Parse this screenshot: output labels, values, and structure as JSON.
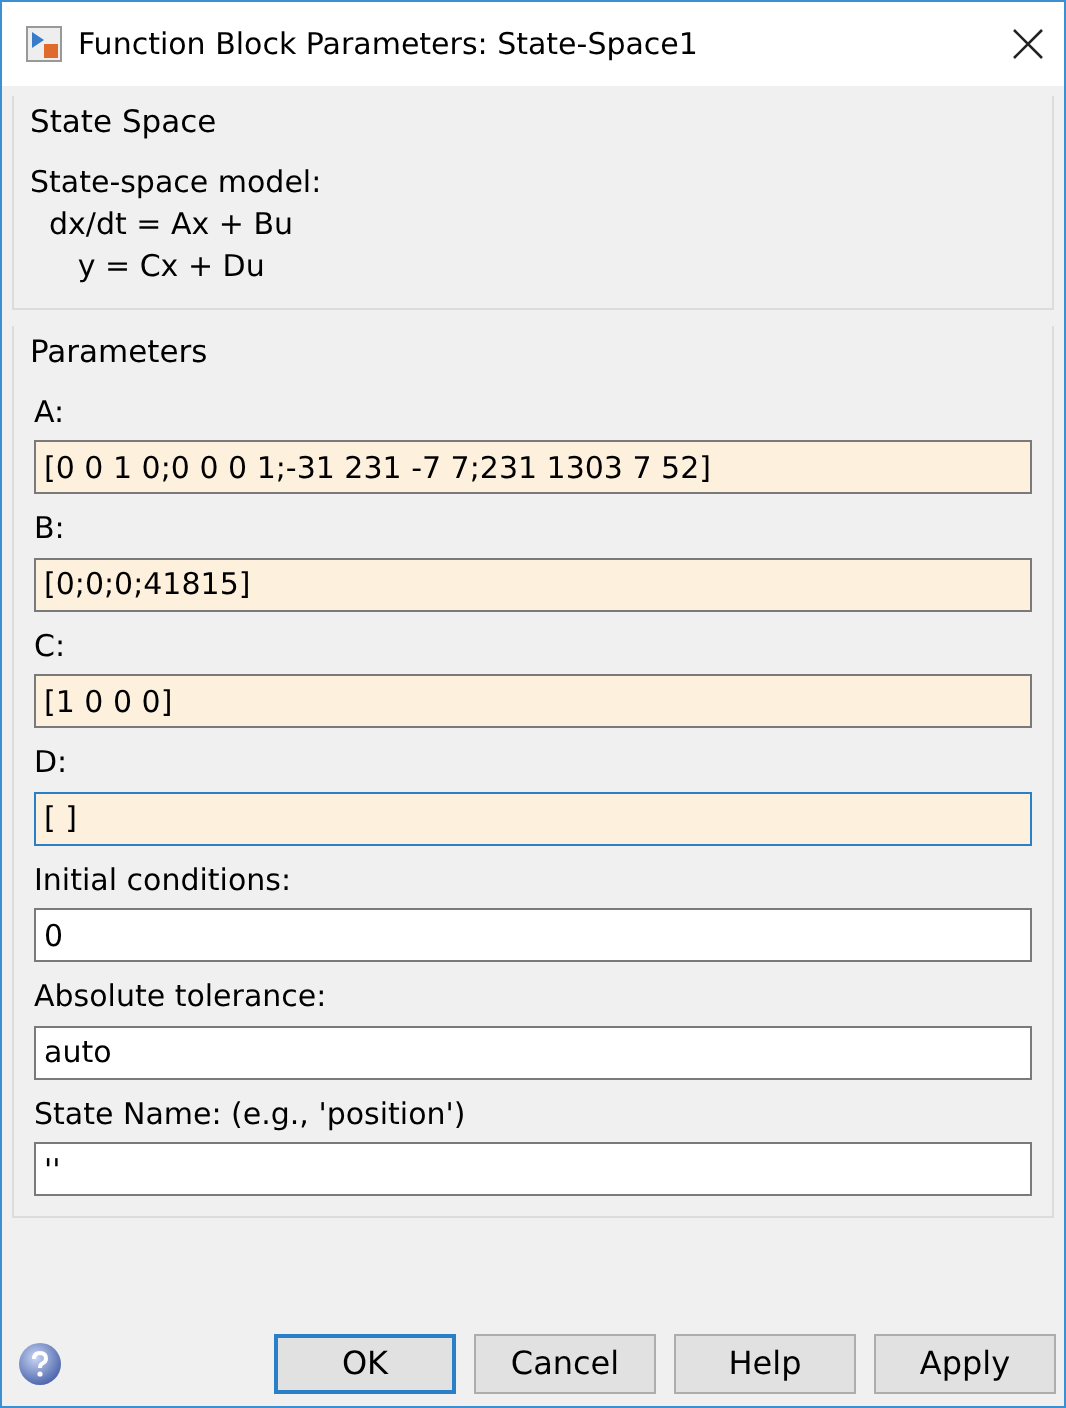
{
  "window": {
    "title": "Function Block Parameters: State-Space1"
  },
  "description_group": {
    "title": "State Space",
    "lines": [
      "State-space model:",
      "  dx/dt = Ax + Bu",
      "     y = Cx + Du"
    ]
  },
  "parameters_group": {
    "title": "Parameters",
    "fields": [
      {
        "label": "A:",
        "value": "[0 0 1 0;0 0 0 1;-31 231 -7 7;231 1303 7 52]",
        "kind": "tunable",
        "focused": false
      },
      {
        "label": "B:",
        "value": "[0;0;0;41815]",
        "kind": "tunable",
        "focused": false
      },
      {
        "label": "C:",
        "value": "[1 0 0 0]",
        "kind": "tunable",
        "focused": false
      },
      {
        "label": "D:",
        "value": "[ ]",
        "kind": "tunable",
        "focused": true
      },
      {
        "label": "Initial conditions:",
        "value": "0",
        "kind": "plain",
        "focused": false
      },
      {
        "label": "Absolute tolerance:",
        "value": "auto",
        "kind": "plain",
        "focused": false
      },
      {
        "label": "State Name: (e.g., 'position')",
        "value": "''",
        "kind": "plain",
        "focused": false
      }
    ]
  },
  "buttons": [
    {
      "label": "OK",
      "default": true
    },
    {
      "label": "Cancel",
      "default": false
    },
    {
      "label": "Help",
      "default": false
    },
    {
      "label": "Apply",
      "default": false
    }
  ]
}
